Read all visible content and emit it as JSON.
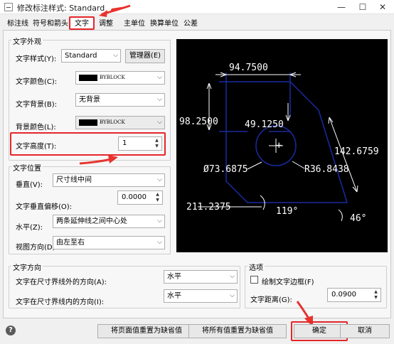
{
  "window": {
    "title": "修改标注样式: Standard",
    "help_label": "?",
    "minimize_label": "—",
    "maximize_label": "☐",
    "close_label": "✕"
  },
  "tabs": [
    {
      "label": "标注线"
    },
    {
      "label": "符号和箭头"
    },
    {
      "label": "文字"
    },
    {
      "label": "调整"
    },
    {
      "label": "主单位"
    },
    {
      "label": "换算单位"
    },
    {
      "label": "公差"
    }
  ],
  "appearance": {
    "group_label": "文字外观",
    "style_label": "文字样式(Y):",
    "style_value": "Standard",
    "manager_button": "管理器(E)",
    "color_label": "文字颜色(C):",
    "color_value": "BYBLOCK",
    "bg_label": "文字背景(B):",
    "bg_value": "无背景",
    "bgcolor_label": "背景颜色(L):",
    "bgcolor_value": "BYBLOCK",
    "height_label": "文字高度(T):",
    "height_value": "1"
  },
  "position": {
    "group_label": "文字位置",
    "vertical_label": "垂直(V):",
    "vertical_value": "尺寸线中间",
    "offset_label": "文字垂直偏移(O):",
    "offset_value": "0.0000",
    "horizontal_label": "水平(Z):",
    "horizontal_value": "两条延伸线之间中心处",
    "view_label": "视图方向(D):",
    "view_value": "由左至右"
  },
  "direction": {
    "group_label": "文字方向",
    "outside_label": "文字在尺寸界线外的方向(A):",
    "outside_value": "水平",
    "inside_label": "文字在尺寸界线内的方向(I):",
    "inside_value": "水平"
  },
  "options": {
    "group_label": "选项",
    "frame_label": "绘制文字边框(F)",
    "frame_checked": false,
    "distance_label": "文字距离(G):",
    "distance_value": "0.0900"
  },
  "preview": {
    "dim_top": "94.7500",
    "dim_left": "98.2500",
    "dim_inner": "49.1250",
    "dim_right": "142.6759",
    "dim_diameter": "Ø73.6875",
    "dim_radius": "R36.8438",
    "dim_bottom": "211.2375",
    "angle_left": "119°",
    "angle_right": "46°",
    "center_mark": "+"
  },
  "footer": {
    "reset_page_button": "将页面值重置为缺省值",
    "reset_all_button": "将所有值重置为缺省值",
    "ok_button": "确定",
    "cancel_button": "取消"
  },
  "colors": {
    "highlight": "#e5262a",
    "preview_bg": "#000000",
    "preview_lines": "#1a2aa0",
    "preview_text": "#ffffff"
  }
}
